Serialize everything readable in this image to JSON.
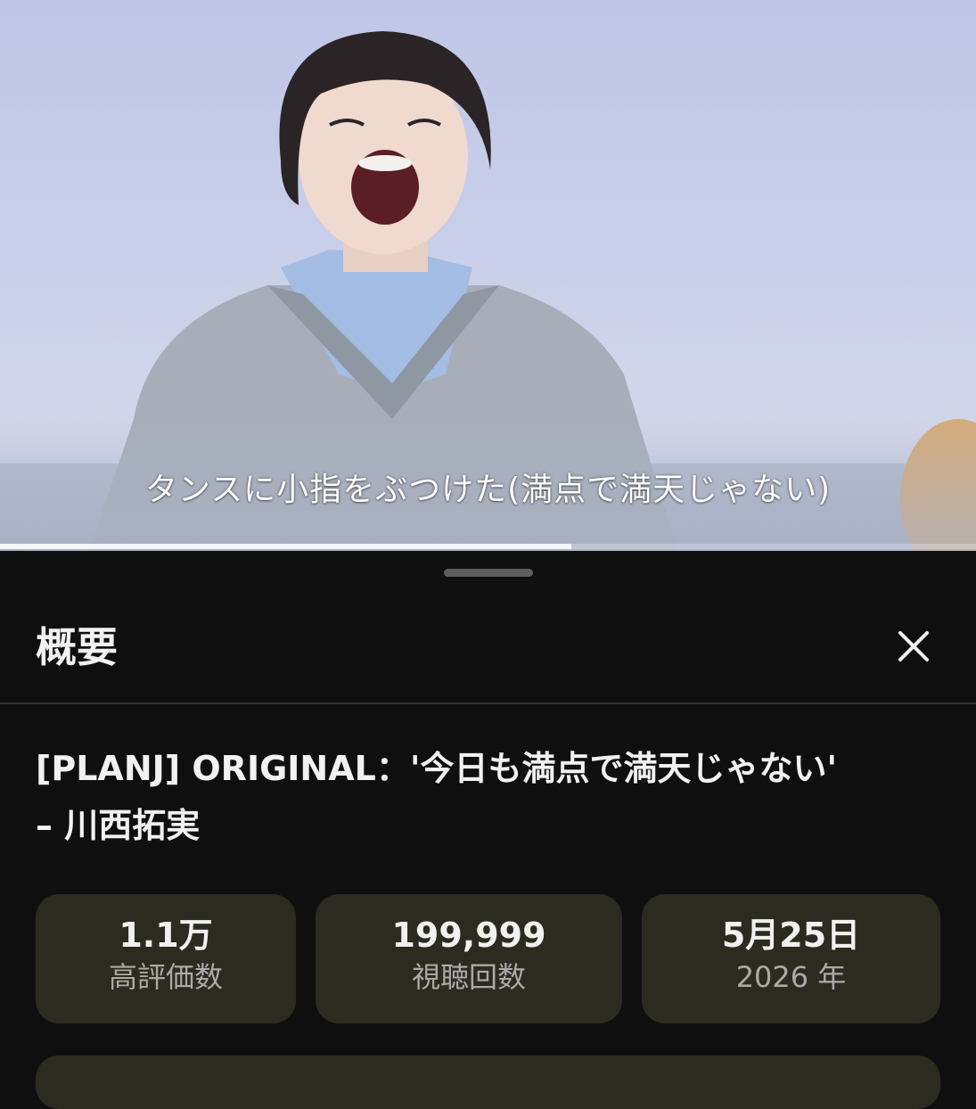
{
  "video": {
    "subtitle": "タンスに小指をぶつけた(満点で満天じゃない)",
    "progress_fraction": 0.585
  },
  "sheet": {
    "title": "概要",
    "close_icon": "close-icon"
  },
  "description": {
    "title_line1": "[PLANJ] ORIGINAL：'今日も満点で満天じゃない'",
    "title_line2": "– 川西拓実"
  },
  "stats": {
    "likes": {
      "value": "1.1万",
      "label": "高評価数"
    },
    "views": {
      "value": "199,999",
      "label": "視聴回数"
    },
    "date": {
      "value": "5月25日",
      "label": "2026 年"
    }
  },
  "colors": {
    "sheet_bg": "#0f0f0f",
    "stat_card_bg": "#2c2b1f",
    "text_primary": "#f1f1f1",
    "text_secondary": "#aaaaaa"
  }
}
